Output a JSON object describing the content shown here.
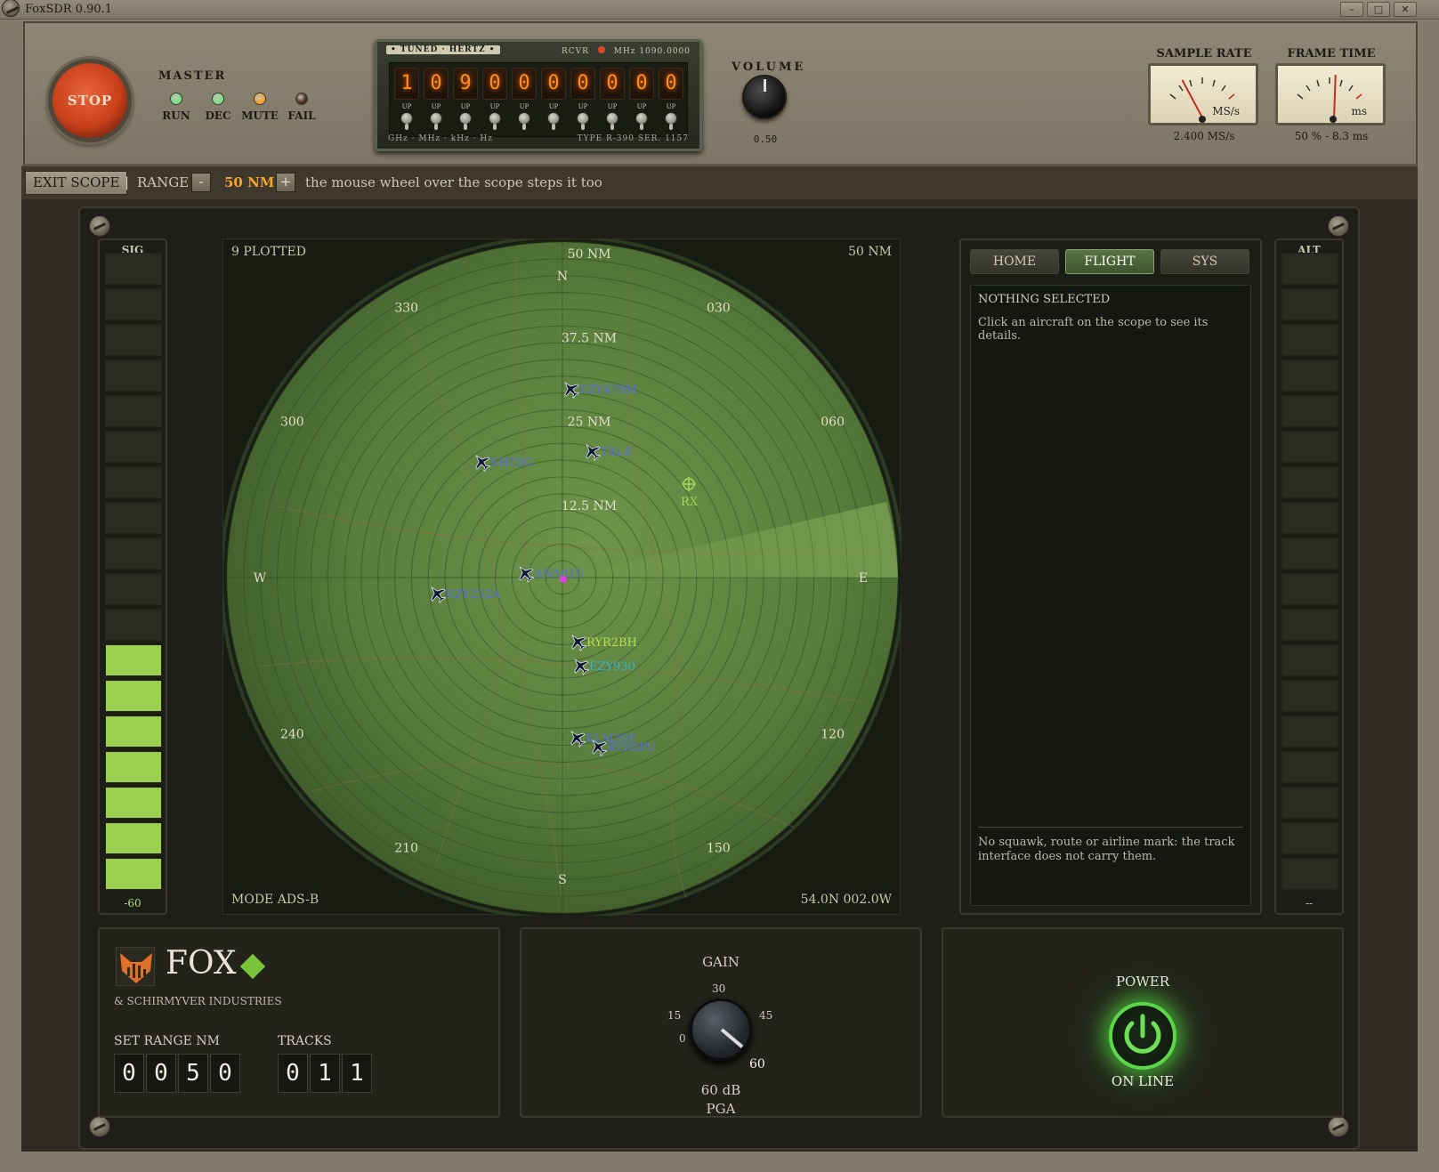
{
  "window": {
    "title": "FoxSDR 0.90.1",
    "min": "–",
    "max": "□",
    "close": "✕"
  },
  "topbar": {
    "stop_label": "STOP",
    "master_label": "MASTER",
    "leds": [
      {
        "label": "RUN",
        "color": "#7ee08a"
      },
      {
        "label": "DEC",
        "color": "#7ee08a"
      },
      {
        "label": "MUTE",
        "color": "#f2a530"
      },
      {
        "label": "FAIL",
        "color": "#4a2f22"
      }
    ],
    "tuner": {
      "header": "• TUNED · HERTZ •",
      "rcvr": "RCVR",
      "mhz": "MHz 1090.0000",
      "digits": [
        "1",
        "0",
        "9",
        "0",
        "0",
        "0",
        "0",
        "0",
        "0",
        "0"
      ],
      "up_label": "UP",
      "footer_left": "GHz · MHz · kHz · Hz",
      "footer_right": "TYPE R-390 SER. 1157"
    },
    "volume": {
      "label": "VOLUME",
      "value": "0.50"
    },
    "sample_rate": {
      "title": "SAMPLE RATE",
      "unit": "MS/s",
      "value": "2.400 MS/s"
    },
    "frame_time": {
      "title": "FRAME TIME",
      "unit": "ms",
      "value": "50 % - 8.3 ms"
    }
  },
  "controlbar": {
    "exit": "EXIT SCOPE",
    "sep": "|",
    "range_label": "RANGE",
    "minus": "-",
    "range_value": "50 NM",
    "plus": "+",
    "hint": "the mouse wheel over the scope steps it too"
  },
  "sig": {
    "title": "SIG",
    "value": "-60",
    "lit": 7,
    "total": 18,
    "color": "#9bd14f"
  },
  "alt": {
    "title": "ALT",
    "value": "--",
    "lit": 0,
    "total": 18
  },
  "scope": {
    "plotted": "9 PLOTTED",
    "range_tr": "50 NM",
    "mode": "MODE ADS-B",
    "position": "54.0N 002.0W",
    "ring_labels": [
      "50 NM",
      "37.5 NM",
      "25 NM",
      "12.5 NM"
    ],
    "cardinals": [
      "N",
      "E",
      "S",
      "W"
    ],
    "bearings": [
      "030",
      "060",
      "120",
      "150",
      "210",
      "240",
      "300",
      "330"
    ],
    "receiver": "RX",
    "aircraft": [
      {
        "callsign": "EZY479M",
        "color": "#5a6de0"
      },
      {
        "callsign": "SHT9G",
        "color": "#5a6de0"
      },
      {
        "callsign": "TAL4",
        "color": "#5a6de0"
      },
      {
        "callsign": "ANA815",
        "color": "#5a6de0"
      },
      {
        "callsign": "EZY252A",
        "color": "#5a6de0"
      },
      {
        "callsign": "RYR2BH",
        "color": "#b8e04a"
      },
      {
        "callsign": "EZY930",
        "color": "#32b0d8"
      },
      {
        "callsign": "KLM39F",
        "color": "#5a6de0"
      },
      {
        "callsign": "RYR8PU",
        "color": "#5a6de0"
      }
    ]
  },
  "info": {
    "tabs": [
      "HOME",
      "FLIGHT",
      "SYS"
    ],
    "active_tab": "FLIGHT",
    "heading": "NOTHING SELECTED",
    "message": "Click an aircraft on the scope to see its details.",
    "footnote": "No squawk, route or airline mark: the track interface does not carry them."
  },
  "brand": {
    "name": "FOX",
    "sub": "& SCHIRMYVER INDUSTRIES",
    "set_range_label": "SET RANGE NM",
    "set_range_digits": [
      "0",
      "0",
      "5",
      "0"
    ],
    "tracks_label": "TRACKS",
    "tracks_digits": [
      "0",
      "1",
      "1"
    ]
  },
  "gain": {
    "label": "GAIN",
    "ticks": [
      "0",
      "15",
      "30",
      "45",
      "60"
    ],
    "value": "60 dB",
    "mode": "PGA"
  },
  "power": {
    "label": "POWER",
    "status": "ON LINE"
  }
}
